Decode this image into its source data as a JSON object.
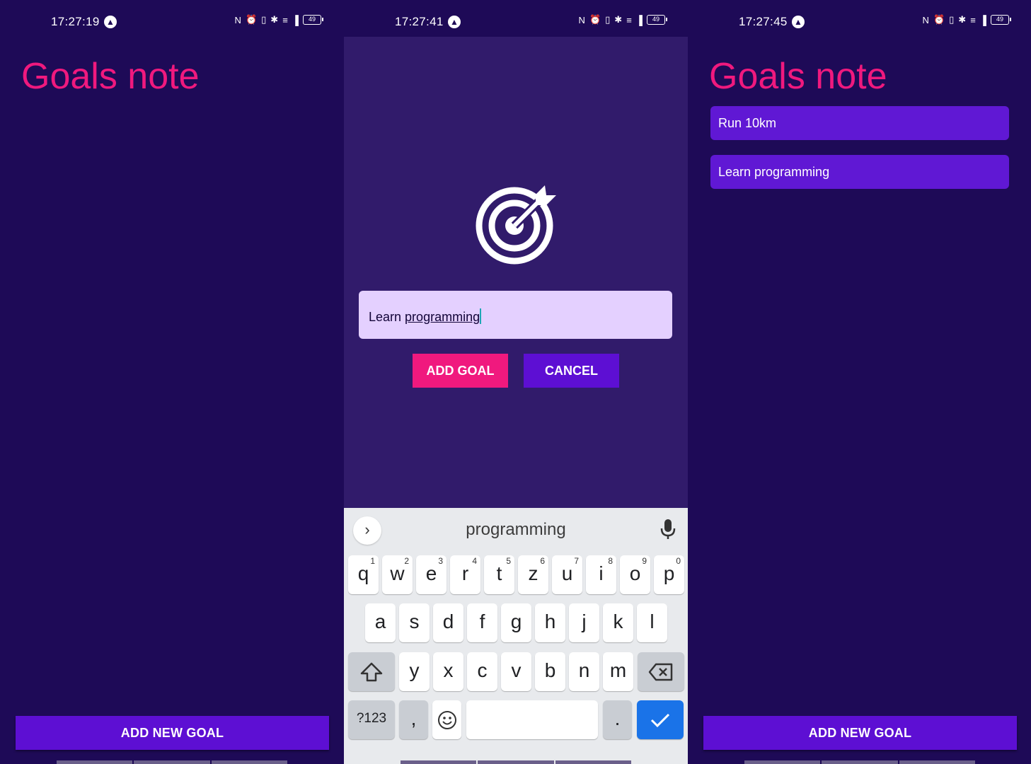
{
  "screens": [
    {
      "status": {
        "time": "17:27:19",
        "battery": "49"
      },
      "title": "Goals note",
      "goals": [],
      "add_button": "ADD NEW GOAL"
    },
    {
      "status": {
        "time": "17:27:41",
        "battery": "49"
      },
      "input": {
        "prefix": "Learn ",
        "word": "programming"
      },
      "add_goal_button": "ADD GOAL",
      "cancel_button": "CANCEL",
      "keyboard": {
        "suggestion": "programming",
        "row1": [
          {
            "k": "q",
            "n": "1"
          },
          {
            "k": "w",
            "n": "2"
          },
          {
            "k": "e",
            "n": "3"
          },
          {
            "k": "r",
            "n": "4"
          },
          {
            "k": "t",
            "n": "5"
          },
          {
            "k": "z",
            "n": "6"
          },
          {
            "k": "u",
            "n": "7"
          },
          {
            "k": "i",
            "n": "8"
          },
          {
            "k": "o",
            "n": "9"
          },
          {
            "k": "p",
            "n": "0"
          }
        ],
        "row2": [
          "a",
          "s",
          "d",
          "f",
          "g",
          "h",
          "j",
          "k",
          "l"
        ],
        "row3": [
          "y",
          "x",
          "c",
          "v",
          "b",
          "n",
          "m"
        ],
        "symbols_key": "?123",
        "comma_key": ",",
        "period_key": "."
      }
    },
    {
      "status": {
        "time": "17:27:45",
        "battery": "49"
      },
      "title": "Goals note",
      "goals": [
        "Run 10km",
        "Learn programming"
      ],
      "add_button": "ADD NEW GOAL"
    }
  ],
  "colors": {
    "background": "#1e0a57",
    "modal_background": "#311b6b",
    "title": "#f0197e",
    "goal_item": "#6018d4",
    "primary_button": "#5d0fd3",
    "accent_button": "#f0197e",
    "input_background": "#e4d0ff"
  },
  "icons": [
    "app-badge-icon",
    "nfc-icon",
    "alarm-icon",
    "vibrate-icon",
    "bluetooth-icon",
    "wifi-icon",
    "signal-icon",
    "battery-icon",
    "target-icon",
    "chevron-right-icon",
    "microphone-icon",
    "shift-icon",
    "backspace-icon",
    "emoji-icon",
    "check-icon"
  ]
}
